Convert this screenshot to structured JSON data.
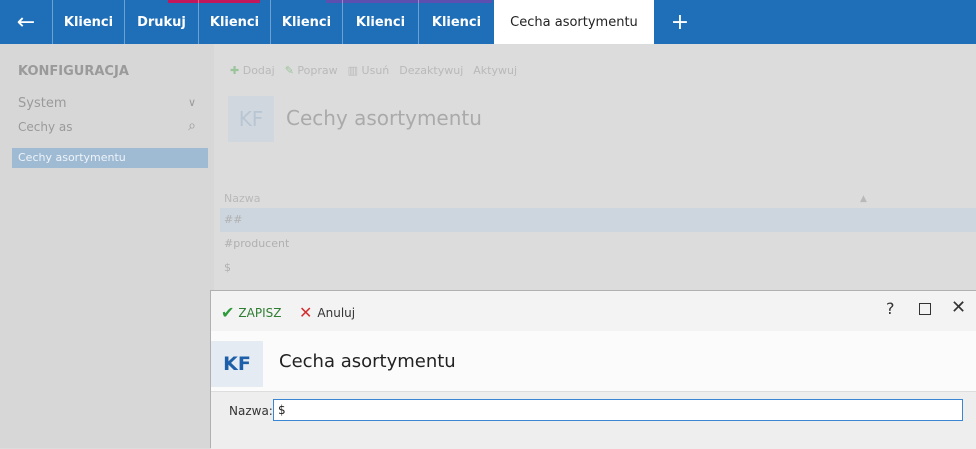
{
  "tabs": [
    {
      "label": "Klienci"
    },
    {
      "label": "Drukuj"
    },
    {
      "label": "Klienci"
    },
    {
      "label": "Klienci"
    },
    {
      "label": "Klienci"
    },
    {
      "label": "Klienci"
    },
    {
      "label": "Cecha asortymentu"
    }
  ],
  "sidebar": {
    "title": "KONFIGURACJA",
    "system": "System",
    "search_value": "Cechy as",
    "selected_item": "Cechy asortymentu"
  },
  "toolbar": {
    "add": "Dodaj",
    "edit": "Popraw",
    "delete": "Usuń",
    "deactivate": "Dezaktywuj",
    "activate": "Aktywuj"
  },
  "main": {
    "badge": "KF",
    "title": "Cechy asortymentu",
    "column_header": "Nazwa",
    "rows": [
      "##",
      "#producent",
      "$"
    ]
  },
  "dialog": {
    "save_label": "ZAPISZ",
    "cancel_label": "Anuluj",
    "help_label": "?",
    "badge": "KF",
    "title": "Cecha asortymentu",
    "field_label": "Nazwa:",
    "field_value": "$"
  },
  "colors": {
    "topbar": "#1e6fb8",
    "accent": "#3a86d4",
    "save_green": "#2e9b3a",
    "cancel_red": "#d32f2f"
  }
}
